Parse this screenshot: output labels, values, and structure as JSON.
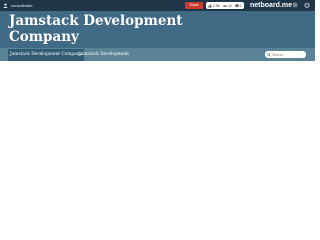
{
  "topbar": {
    "username": "consultmate",
    "share_label": "Share",
    "likes": {
      "count": "2.9K",
      "second": "1k",
      "third": "0"
    },
    "brand": "netboard.me"
  },
  "header": {
    "title": "Jamstack Development Company"
  },
  "tabs": [
    {
      "label": "Jamstack Development Company",
      "active": true
    },
    {
      "label": "Jamstack Development",
      "active": false
    }
  ],
  "search": {
    "placeholder": "Search"
  },
  "icons": {
    "user": "user-icon",
    "like": "thumbs-up-icon",
    "eye": "eye-icon",
    "comment": "comment-icon",
    "settings": "gear-icon",
    "power": "power-icon",
    "search": "search-icon"
  },
  "colors": {
    "topbar": "#1f3548",
    "header": "#416b85",
    "tabbar": "#5b8398",
    "active_tab": "#2f5b75",
    "share": "#cc3b30"
  }
}
